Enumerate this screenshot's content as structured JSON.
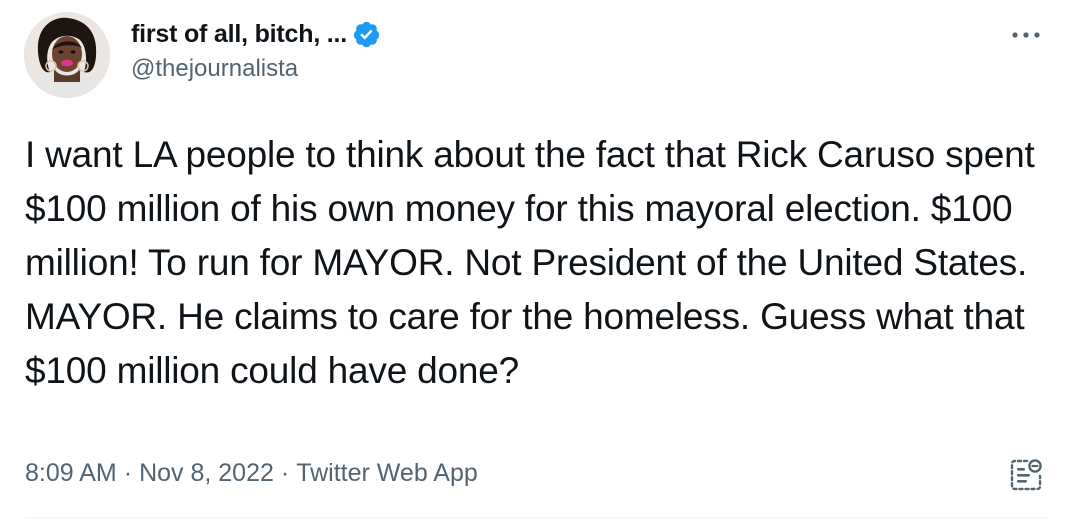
{
  "tweet": {
    "author": {
      "display_name": "first of all, bitch, ...",
      "handle": "@thejournalista",
      "verified": true,
      "avatar_icon": "profile-photo-avatar"
    },
    "text": "I want LA people to think about the fact that Rick Caruso spent $100 million of his own money for this mayoral election. $100 million! To run for MAYOR. Not President of the United States. MAYOR. He claims to care for the homeless. Guess what that $100 million could have done?",
    "time": "8:09 AM",
    "separator": "·",
    "date": "Nov 8, 2022",
    "source": "Twitter Web App",
    "icons": {
      "more": "more-options-icon",
      "verified": "verified-badge-icon",
      "analytics": "view-tweet-analytics-icon"
    }
  },
  "colors": {
    "text_primary": "#0f1419",
    "text_secondary": "#536471",
    "verified_blue": "#1d9bf0",
    "divider": "#eff3f4",
    "background": "#ffffff"
  }
}
